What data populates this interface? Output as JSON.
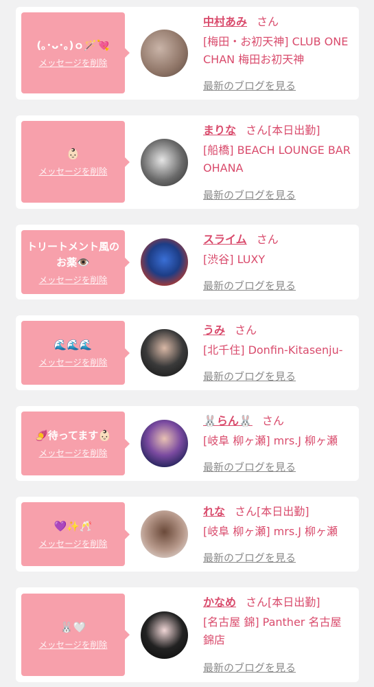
{
  "delete_label": "メッセージを削除",
  "blog_label": "最新のブログを見る",
  "colors": {
    "accent": "#d94b6c",
    "bubble": "#f7a0ab",
    "background": "#f1f1f2"
  },
  "messages": [
    {
      "message": "(｡･ᴗ･｡)ｏ🪄💘",
      "name": "中村あみ",
      "suffix": "さん",
      "shop": "[梅田・お初天神] CLUB ONE CHAN 梅田お初天神"
    },
    {
      "message": "👶🏻",
      "name": "まりな",
      "suffix": "さん[本日出勤]",
      "shop": "[船橋] BEACH LOUNGE BAR OHANA"
    },
    {
      "message": "トリートメント風のお薬👁️",
      "name": "スライム",
      "suffix": "さん",
      "shop": "[渋谷] LUXY"
    },
    {
      "message": "🌊🌊🌊",
      "name": "うみ",
      "suffix": "さん",
      "shop": "[北千住] Donfin-Kitasenju-"
    },
    {
      "message": "🍠待ってます👶🏻",
      "name": "🐰らん🐰",
      "suffix": "さん",
      "shop": "[岐阜 柳ヶ瀬] mrs.J 柳ヶ瀬"
    },
    {
      "message": "💜✨🥂",
      "name": "れな",
      "suffix": "さん[本日出勤]",
      "shop": "[岐阜 柳ヶ瀬] mrs.J 柳ヶ瀬"
    },
    {
      "message": "🐰🤍",
      "name": "かなめ",
      "suffix": "さん[本日出勤]",
      "shop": "[名古屋 錦] Panther 名古屋錦店"
    }
  ]
}
